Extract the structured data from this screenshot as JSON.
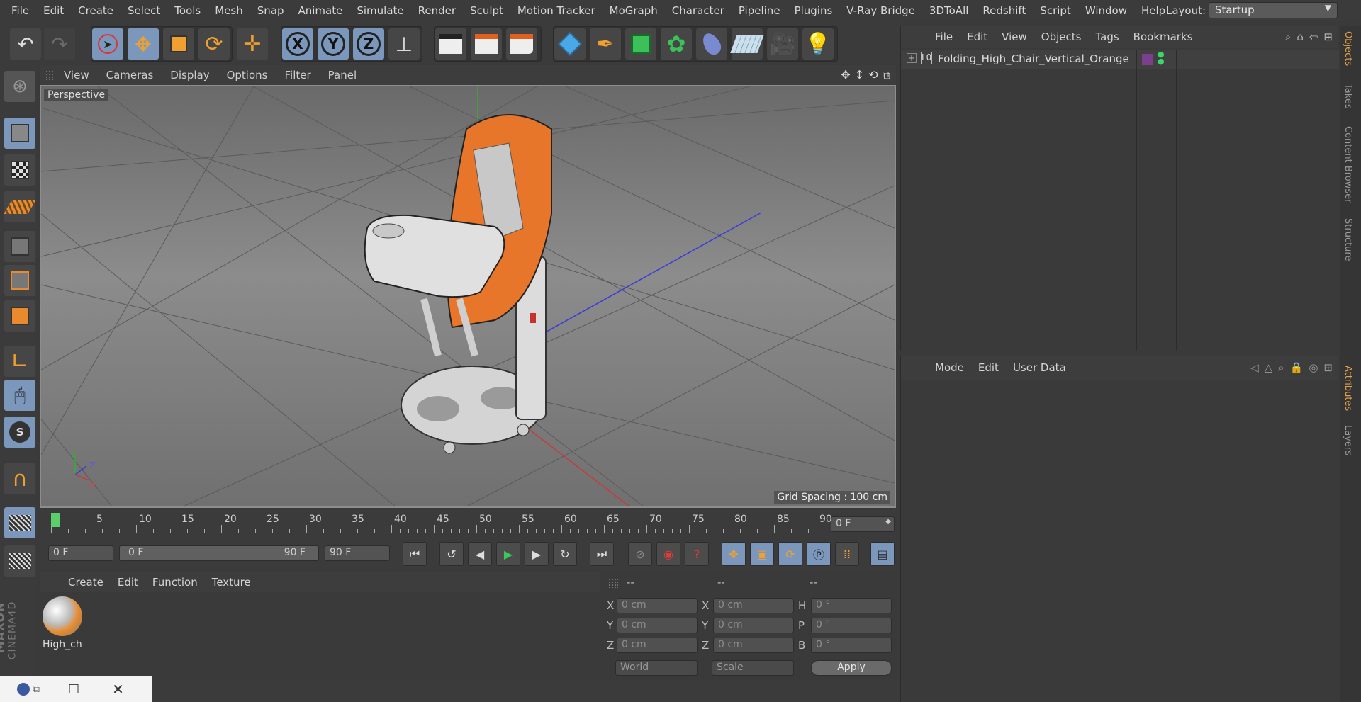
{
  "menu": [
    "File",
    "Edit",
    "Create",
    "Select",
    "Tools",
    "Mesh",
    "Snap",
    "Animate",
    "Simulate",
    "Render",
    "Sculpt",
    "Motion Tracker",
    "MoGraph",
    "Character",
    "Pipeline",
    "Plugins",
    "V-Ray Bridge",
    "3DToAll",
    "Redshift",
    "Script",
    "Window",
    "Help"
  ],
  "layout": {
    "label": "Layout:",
    "value": "Startup"
  },
  "viewport": {
    "menu": [
      "View",
      "Cameras",
      "Display",
      "Options",
      "Filter",
      "Panel"
    ],
    "label": "Perspective",
    "grid_spacing": "Grid Spacing : 100 cm",
    "axis_labels": {
      "y": "Y",
      "z": "Z",
      "x": "X"
    }
  },
  "timeline": {
    "ticks": [
      "0",
      "5",
      "10",
      "15",
      "20",
      "25",
      "30",
      "35",
      "40",
      "45",
      "50",
      "55",
      "60",
      "65",
      "70",
      "75",
      "80",
      "85",
      "90"
    ],
    "current_frame": "0 F"
  },
  "transport": {
    "start_field": "0 F",
    "range_start": "0 F",
    "range_end": "90 F",
    "end_field": "90 F"
  },
  "materials": {
    "menu": [
      "Create",
      "Edit",
      "Function",
      "Texture"
    ],
    "items": [
      {
        "name": "High_ch"
      }
    ]
  },
  "coordinates": {
    "headers": [
      "--",
      "--",
      "--"
    ],
    "rows": [
      {
        "l1": "X",
        "v1": "0 cm",
        "l2": "X",
        "v2": "0 cm",
        "l3": "H",
        "v3": "0 °"
      },
      {
        "l1": "Y",
        "v1": "0 cm",
        "l2": "Y",
        "v2": "0 cm",
        "l3": "P",
        "v3": "0 °"
      },
      {
        "l1": "Z",
        "v1": "0 cm",
        "l2": "Z",
        "v2": "0 cm",
        "l3": "B",
        "v3": "0 °"
      }
    ],
    "mode_world": "World",
    "mode_scale": "Scale",
    "apply": "Apply"
  },
  "objects": {
    "menu": [
      "File",
      "Edit",
      "View",
      "Objects",
      "Tags",
      "Bookmarks"
    ],
    "items": [
      {
        "name": "Folding_High_Chair_Vertical_Orange",
        "layer_color": "#7b3f8c"
      }
    ]
  },
  "attributes": {
    "menu": [
      "Mode",
      "Edit",
      "User Data"
    ]
  },
  "right_tabs": [
    "Objects",
    "Takes",
    "Content Browser",
    "Structure",
    "Attributes",
    "Layers"
  ],
  "brand": {
    "name": "MAXON",
    "product": "CINEMA4D"
  },
  "colors": {
    "accent_blue": "#7b98bc",
    "orange": "#e88b2e",
    "tab_active": "#e8a34a"
  }
}
